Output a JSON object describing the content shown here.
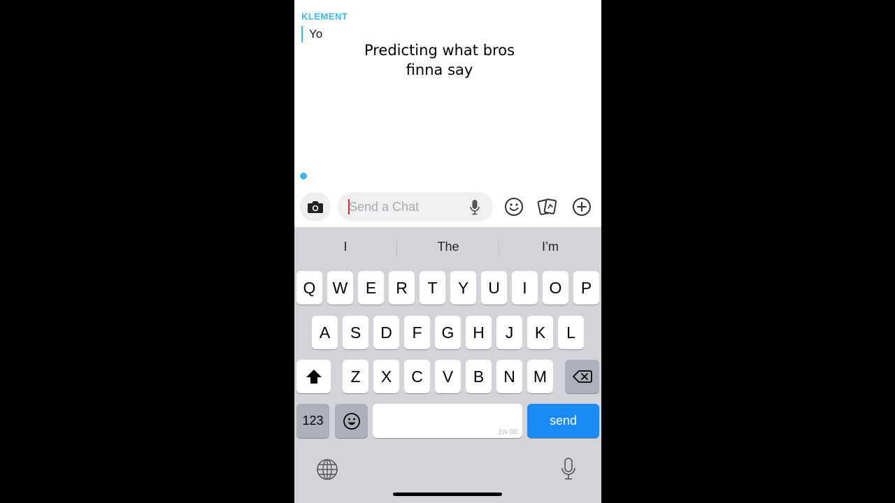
{
  "chat": {
    "sender_name": "KLEMENT",
    "message": "Yo",
    "caption_line1": "Predicting what bros",
    "caption_line2": "finna say"
  },
  "input_bar": {
    "placeholder": "Send a Chat",
    "value": "",
    "icons": [
      "camera-icon",
      "microphone-icon",
      "smiley-icon",
      "sticker-icon",
      "plus-icon"
    ]
  },
  "keyboard": {
    "suggestions": [
      "I",
      "The",
      "I’m"
    ],
    "row1": [
      "Q",
      "W",
      "E",
      "R",
      "T",
      "Y",
      "U",
      "I",
      "O",
      "P"
    ],
    "row2": [
      "A",
      "S",
      "D",
      "F",
      "G",
      "H",
      "J",
      "K",
      "L"
    ],
    "row3": [
      "Z",
      "X",
      "C",
      "V",
      "B",
      "N",
      "M"
    ],
    "numbers_label": "123",
    "send_label": "send",
    "language_hint": "EN DE",
    "icons": [
      "shift-icon",
      "backspace-icon",
      "emoji-icon",
      "globe-icon",
      "dictation-mic-icon"
    ]
  },
  "colors": {
    "accent": "#3bb8e8",
    "send_button": "#1a8bf5",
    "keyboard_bg": "#d2d4d9",
    "cursor": "#e0213a"
  }
}
